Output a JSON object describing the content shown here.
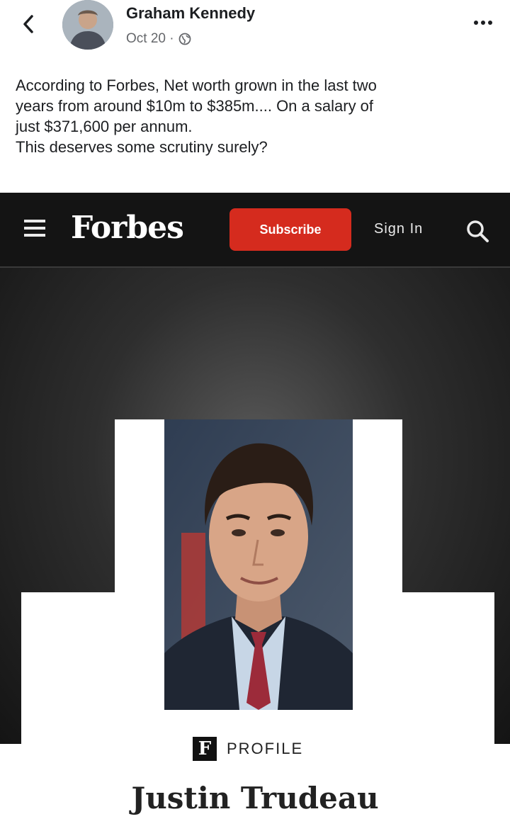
{
  "post": {
    "author": "Graham Kennedy",
    "date": "Oct 20 ·",
    "text_lines": [
      "According to Forbes, Net worth grown in the last two",
      "years from around $10m to $385m.... On a salary of",
      "just $371,600 per annum.",
      "This deserves some scrutiny surely?"
    ],
    "icons": {
      "back": "chevron-left-icon",
      "privacy": "globe-icon",
      "more": "more-options-icon"
    }
  },
  "forbes": {
    "logo": "Forbes",
    "subscribe_label": "Subscribe",
    "sign_in_label": "Sign In",
    "profile_badge": "F",
    "profile_label": "PROFILE",
    "profile_name": "Justin Trudeau",
    "colors": {
      "subscribe": "#d52b1e",
      "nav_bg": "#141414"
    }
  }
}
